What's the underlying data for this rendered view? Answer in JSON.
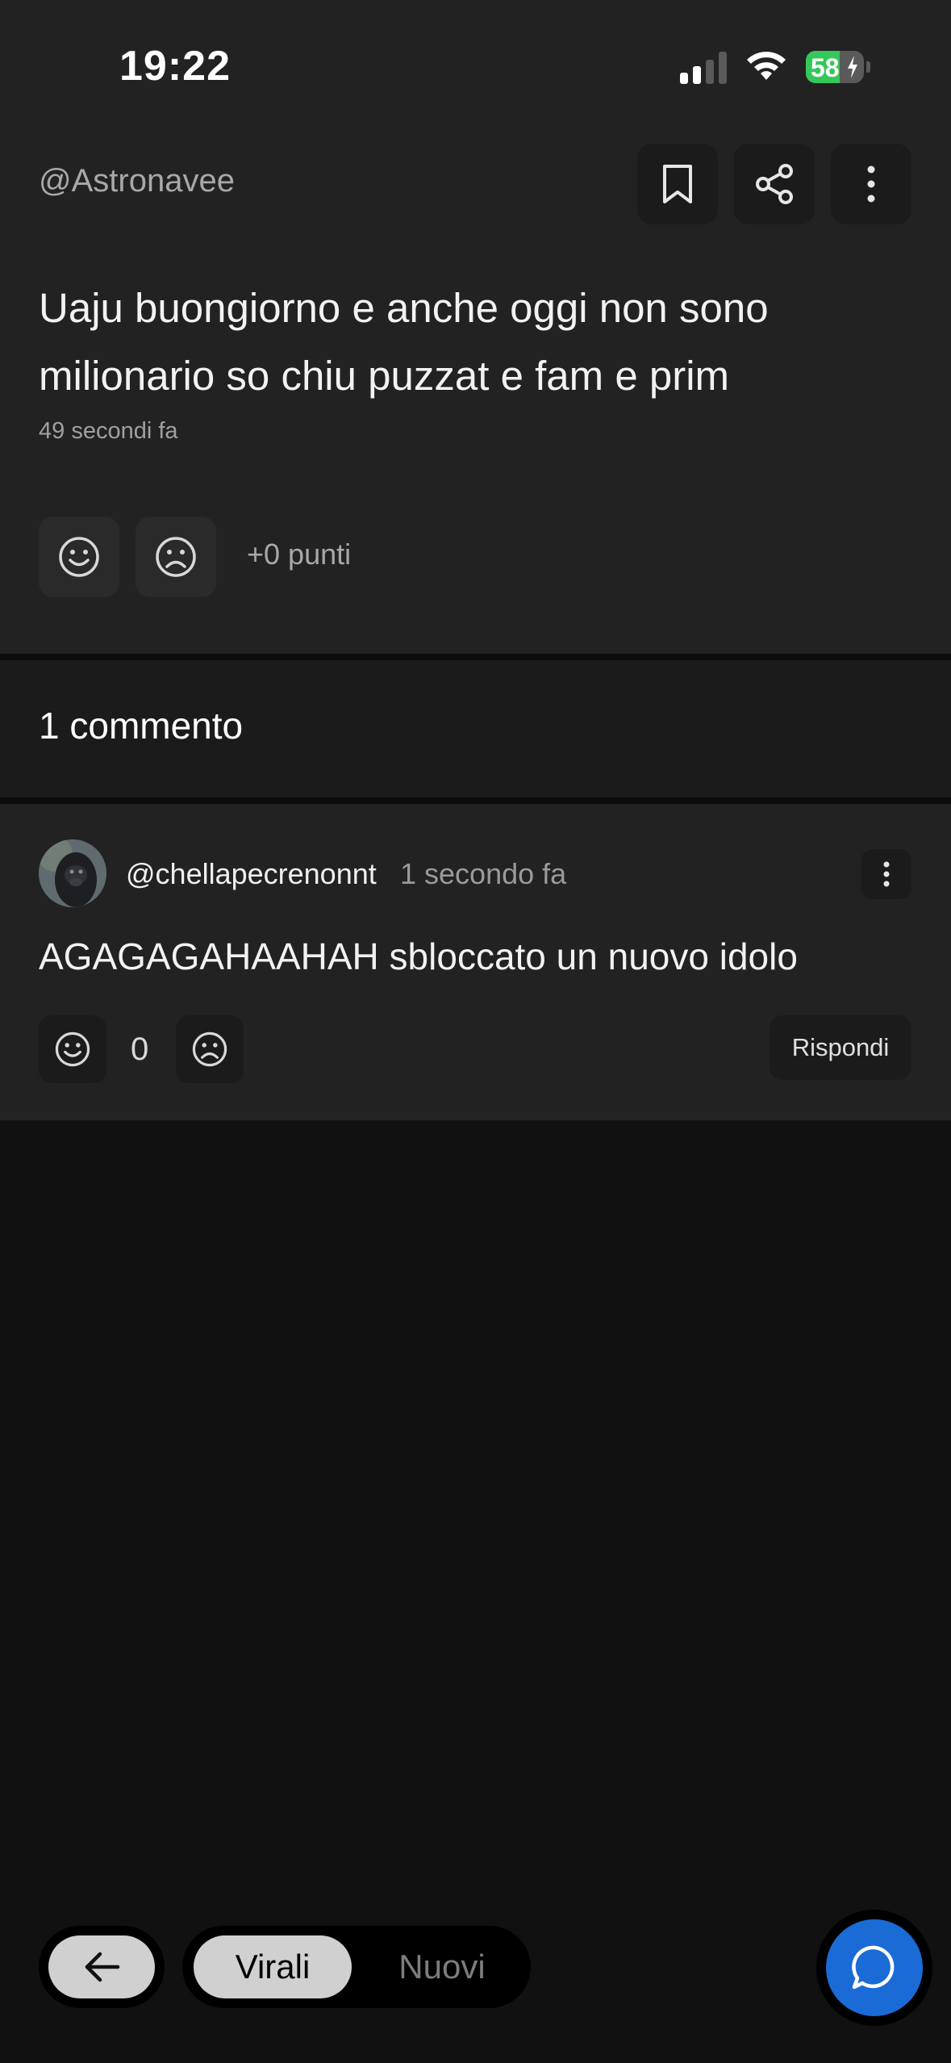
{
  "status_bar": {
    "time": "19:22",
    "battery_percent": "58",
    "battery_level": 0.58,
    "signal_bars_active": 2,
    "signal_bars_total": 4
  },
  "post": {
    "author": "@Astronavee",
    "text": "Uaju buongiorno e anche oggi non sono milionario so chiu puzzat e fam e prim",
    "time": "49 secondi fa",
    "points": "+0 punti"
  },
  "comments_section": {
    "title": "1 commento"
  },
  "comment": {
    "username": "@chellapecrenonnt",
    "time": "1 secondo fa",
    "text": "AGAGAGAHAAHAH sbloccato un nuovo idolo",
    "score": "0",
    "reply_label": "Rispondi"
  },
  "bottom_nav": {
    "tabs": [
      {
        "label": "Virali",
        "active": true
      },
      {
        "label": "Nuovi",
        "active": false
      }
    ]
  },
  "colors": {
    "background": "#111111",
    "card": "#222223",
    "accent_blue": "#1a6bd6",
    "battery_green": "#34c759"
  }
}
